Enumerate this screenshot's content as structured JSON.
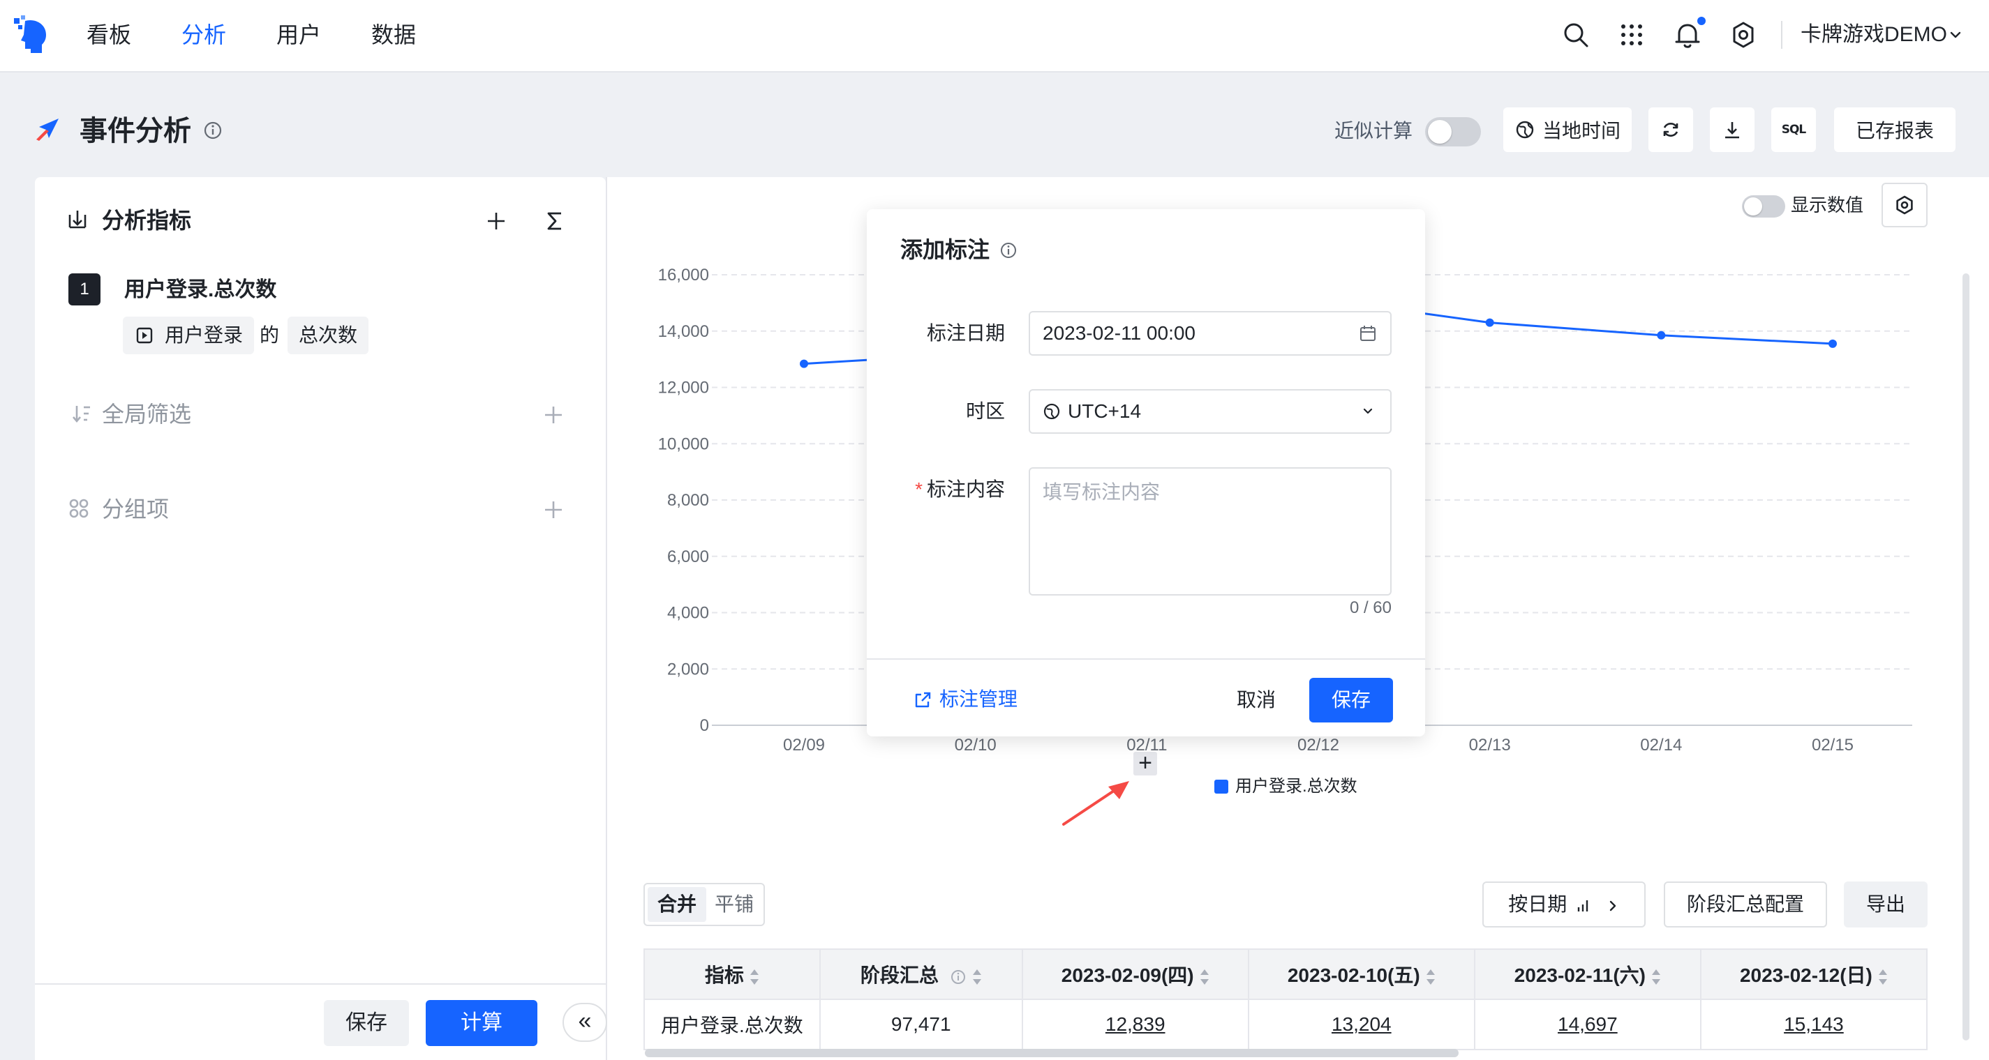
{
  "nav": {
    "items": [
      {
        "label": "看板",
        "active": false
      },
      {
        "label": "分析",
        "active": true
      },
      {
        "label": "用户",
        "active": false
      },
      {
        "label": "数据",
        "active": false
      }
    ],
    "account": "卡牌游戏DEMO",
    "accent_color": "#1664ff"
  },
  "header": {
    "title": "事件分析",
    "approx_label": "近似计算",
    "approx_on": false,
    "local_time_label": "当地时间",
    "sql_label": "SQL",
    "saved_reports_label": "已存报表"
  },
  "left_panel": {
    "metrics_title": "分析指标",
    "metric_index": "1",
    "metric_name": "用户登录.总次数",
    "event_chip": "用户登录",
    "of_text": "的",
    "measure_chip": "总次数",
    "global_filter_title": "全局筛选",
    "group_title": "分组项",
    "save_label": "保存",
    "calc_label": "计算",
    "collapse_label": "«"
  },
  "chart_toolbar": {
    "show_values_label": "显示数值",
    "show_values_on": false
  },
  "chart_data": {
    "type": "line",
    "categories": [
      "02/09",
      "02/10",
      "02/11",
      "02/12",
      "02/13",
      "02/14",
      "02/15"
    ],
    "series": [
      {
        "name": "用户登录.总次数",
        "color": "#1664ff",
        "values": [
          12839,
          13204,
          14697,
          15143,
          14300,
          13850,
          13550
        ]
      }
    ],
    "ylim": [
      0,
      16000
    ],
    "yticks": [
      "0",
      "2,000",
      "4,000",
      "6,000",
      "8,000",
      "10,000",
      "12,000",
      "14,000",
      "16,000"
    ],
    "grid": true,
    "legend": "bottom"
  },
  "modal": {
    "title": "添加标注",
    "date_label": "标注日期",
    "date_value": "2023-02-11 00:00",
    "tz_label": "时区",
    "tz_value": "UTC+14",
    "content_label": "标注内容",
    "content_placeholder": "填写标注内容",
    "counter": "0 / 60",
    "manage_label": "标注管理",
    "cancel_label": "取消",
    "save_label": "保存"
  },
  "table_toolbar": {
    "merge_label": "合并",
    "tile_label": "平铺",
    "by_date_label": "按日期",
    "stage_config_label": "阶段汇总配置",
    "export_label": "导出"
  },
  "table": {
    "headers": [
      "指标",
      "阶段汇总",
      "2023-02-09(四)",
      "2023-02-10(五)",
      "2023-02-11(六)",
      "2023-02-12(日)"
    ],
    "rows": [
      [
        "用户登录.总次数",
        "97,471",
        "12,839",
        "13,204",
        "14,697",
        "15,143"
      ]
    ]
  }
}
